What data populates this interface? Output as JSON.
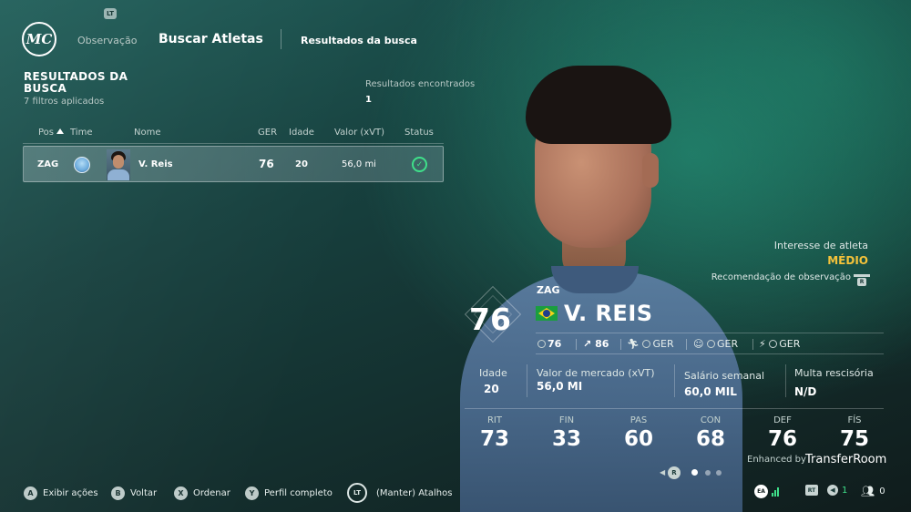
{
  "header": {
    "logo_text": "MC",
    "lt_badge": "LT",
    "nav_observacao": "Observação",
    "nav_buscar": "Buscar Atletas",
    "nav_resultados": "Resultados da busca"
  },
  "results": {
    "title": "RESULTADOS DA BUSCA",
    "filters": "7 filtros aplicados",
    "found_label": "Resultados encontrados",
    "found_value": "1"
  },
  "table": {
    "columns": [
      "Pos",
      "Time",
      "Nome",
      "GER",
      "Idade",
      "Valor (xVT)",
      "Status"
    ],
    "rows": [
      {
        "pos": "ZAG",
        "team": "Manchester City",
        "name": "V. Reis",
        "ger": "76",
        "age": "20",
        "value": "56,0 mi",
        "status": "check"
      }
    ]
  },
  "player": {
    "position": "ZAG",
    "overall": "76",
    "name": "V. REIS",
    "nationality": "Brazil",
    "interest_label": "Interesse de atleta",
    "interest_value": "MÉDIO",
    "recommendation_label": "Recomendação de observação",
    "chips": {
      "current": "76",
      "potential": "86",
      "ger1": "GER",
      "ger2": "GER",
      "ger3": "GER"
    },
    "info": {
      "age_label": "Idade",
      "age_value": "20",
      "market_label": "Valor de mercado (xVT)",
      "market_value": "56,0 MI",
      "salary_label": "Salário semanal",
      "salary_value": "60,0 MIL",
      "release_label": "Multa rescisória",
      "release_value": "N/D"
    },
    "stats": [
      {
        "label": "RIT",
        "value": "73"
      },
      {
        "label": "FIN",
        "value": "33"
      },
      {
        "label": "PAS",
        "value": "60"
      },
      {
        "label": "CON",
        "value": "68"
      },
      {
        "label": "DEF",
        "value": "76"
      },
      {
        "label": "FÍS",
        "value": "75"
      }
    ],
    "enhanced_by": "Enhanced by",
    "transferroom": "TransferRoom"
  },
  "pager": {
    "button": "R",
    "pages": 3,
    "active": 1
  },
  "footer": {
    "buttons": [
      {
        "glyph": "A",
        "label": "Exibir ações"
      },
      {
        "glyph": "B",
        "label": "Voltar"
      },
      {
        "glyph": "X",
        "label": "Ordenar"
      },
      {
        "glyph": "Y",
        "label": "Perfil completo"
      },
      {
        "glyph": "LT",
        "label": "(Manter) Atalhos"
      }
    ],
    "ea_text": "EA",
    "rt_text": "RT",
    "audio_count": "1",
    "party_count": "0"
  },
  "colors": {
    "accent_green": "#3fe08a",
    "interest_yellow": "#f4c23a"
  }
}
